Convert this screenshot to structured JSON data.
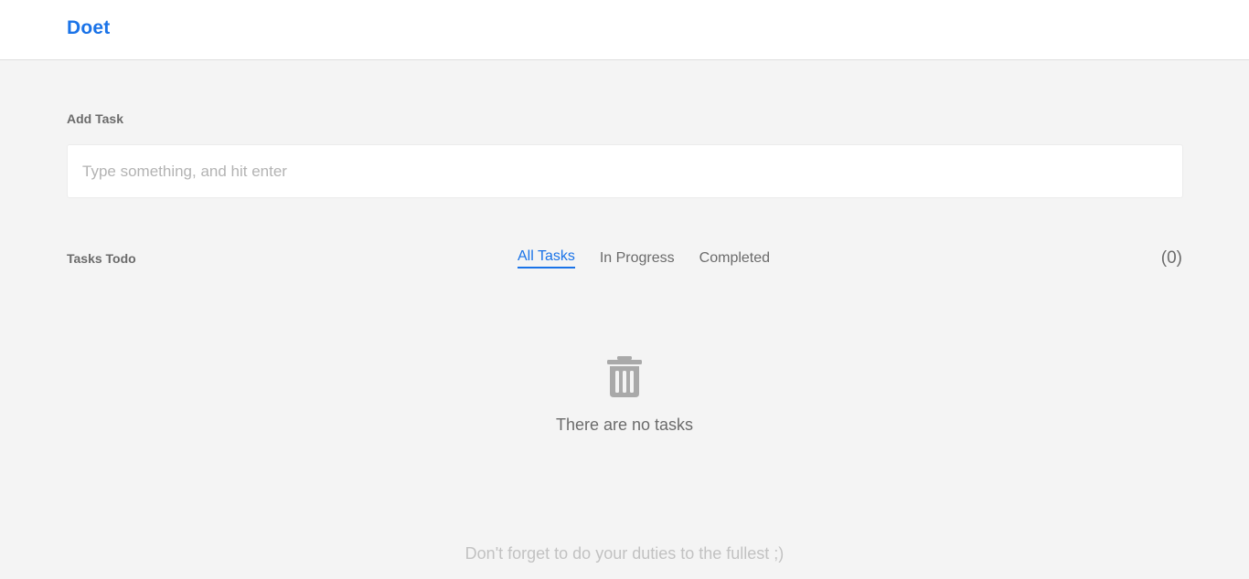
{
  "header": {
    "brand": "Doet"
  },
  "add_task": {
    "label": "Add Task",
    "input_value": "",
    "placeholder": "Type something, and hit enter"
  },
  "tasks": {
    "label": "Tasks Todo",
    "tabs": [
      {
        "label": "All Tasks",
        "active": true
      },
      {
        "label": "In Progress",
        "active": false
      },
      {
        "label": "Completed",
        "active": false
      }
    ],
    "count": "(0)",
    "empty_icon": "trash-icon",
    "empty_text": "There are no tasks"
  },
  "footer": {
    "text": "Don't forget to do your duties to the fullest ;)"
  },
  "colors": {
    "accent": "#1a73e8",
    "background": "#f4f4f4",
    "text": "#6b6b6b"
  }
}
